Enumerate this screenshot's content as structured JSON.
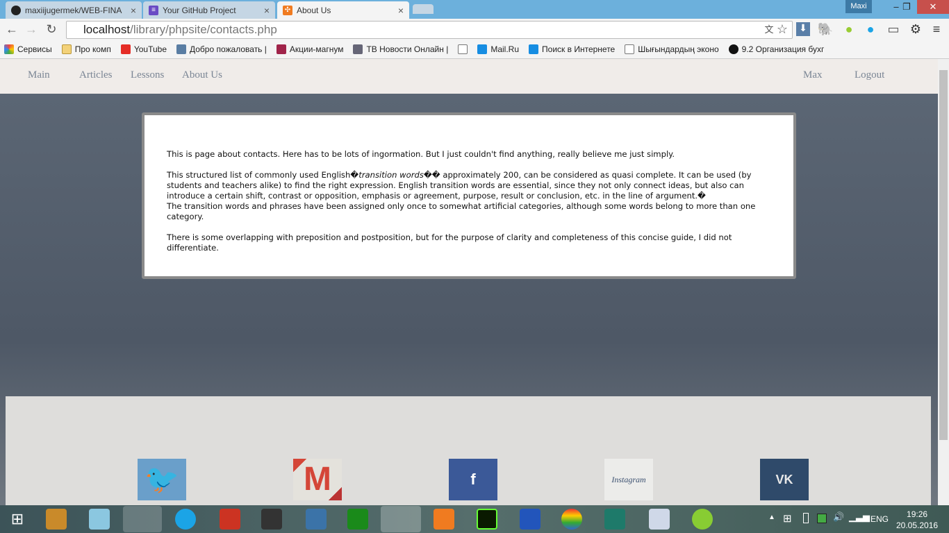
{
  "browser": {
    "tabs": [
      {
        "label": "maxiijugermek/WEB-FINA",
        "icon": "github-icon",
        "active": false
      },
      {
        "label": "Your GitHub Project",
        "icon": "list-icon",
        "active": false
      },
      {
        "label": "About Us",
        "icon": "xampp-icon",
        "active": true
      }
    ],
    "user": "Maxi",
    "url_host": "localhost",
    "url_path": "/library/phpsite/contacts.php",
    "bookmarks": [
      "Сервисы",
      "Про комп",
      "YouTube",
      "Добро пожаловать |",
      "Акции-магнум",
      "ТВ Новости Онлайн |",
      "",
      "Mail.Ru",
      "Поиск в Интернете",
      "Шығындардың эконо",
      "9.2 Организация бухг"
    ]
  },
  "nav": {
    "left": [
      "Main",
      "Articles",
      "Lessons",
      "About Us"
    ],
    "right": [
      "Max",
      "Logout"
    ]
  },
  "content": {
    "p1": "This is page about contacts. Here has to be lots of ingormation. But I just couldn't find anything, really believe me just simply.",
    "p2a": "This structured list of commonly used English�",
    "p2em": "transition words",
    "p2b": "�� approximately 200, can be considered as quasi complete. It can be used (by students and teachers alike) to find the right expression. English transition words are essential, since they not only connect ideas, but also can introduce a certain shift, contrast or opposition, emphasis or agreement, purpose, result or conclusion, etc. in the line of argument.�",
    "p2c": "The transition words and phrases have been assigned only once to somewhat artificial categories, although some words belong to more than one category.",
    "p3": "There is some overlapping with preposition and postposition, but for the purpose of clarity and completeness of this concise guide, I did not differentiate."
  },
  "social": [
    {
      "name": "twitter",
      "color": "#6a9fca"
    },
    {
      "name": "gmail",
      "color": "#d44638"
    },
    {
      "name": "facebook",
      "label": "f",
      "color": "#3b5998"
    },
    {
      "name": "instagram",
      "label": "Instagram",
      "color": "#ececea"
    },
    {
      "name": "vk",
      "label": "VK",
      "color": "#2f4a6a"
    }
  ],
  "taskbar": {
    "lang": "ENG",
    "time": "19:26",
    "date": "20.05.2016"
  }
}
